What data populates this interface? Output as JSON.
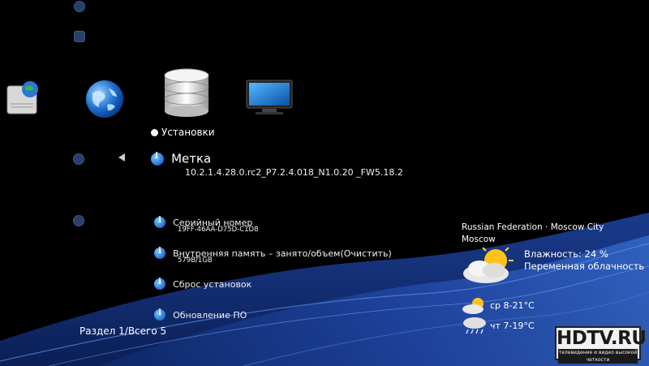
{
  "menu": {
    "section_label": "Установки",
    "selected": {
      "title": "Метка",
      "value": "10.2.1.4.28.0.rc2_P7.2.4.018_N1.0.20 _FW5.18.2"
    },
    "items": [
      {
        "title": "Серийный номер",
        "value": "19FF-46AA-D75D-C1D8"
      },
      {
        "title": "Внутренняя память – занято/объем(Очистить)",
        "value": "579B/1GB"
      },
      {
        "title": "Сброс установок",
        "value": ""
      },
      {
        "title": "Обновление ПО",
        "value": ""
      }
    ]
  },
  "pager": {
    "text": "Раздел 1/Всего 5"
  },
  "weather": {
    "location": "Russian Federation · Moscow City",
    "city": "Moscow",
    "humidity": "Влажность: 24  %",
    "condition": "Переменная облачность",
    "forecast": [
      {
        "text": "ср 8-21°C",
        "icon": "partly-cloudy-icon"
      },
      {
        "text": "чт 7-19°C",
        "icon": "rain-cloud-icon"
      }
    ]
  },
  "watermark": {
    "brand": "HDTV.RU",
    "tagline": "телевидение и видео высокой четкости"
  },
  "icons": [
    "network-drive-icon",
    "globe-icon",
    "database-icon",
    "monitor-icon"
  ]
}
